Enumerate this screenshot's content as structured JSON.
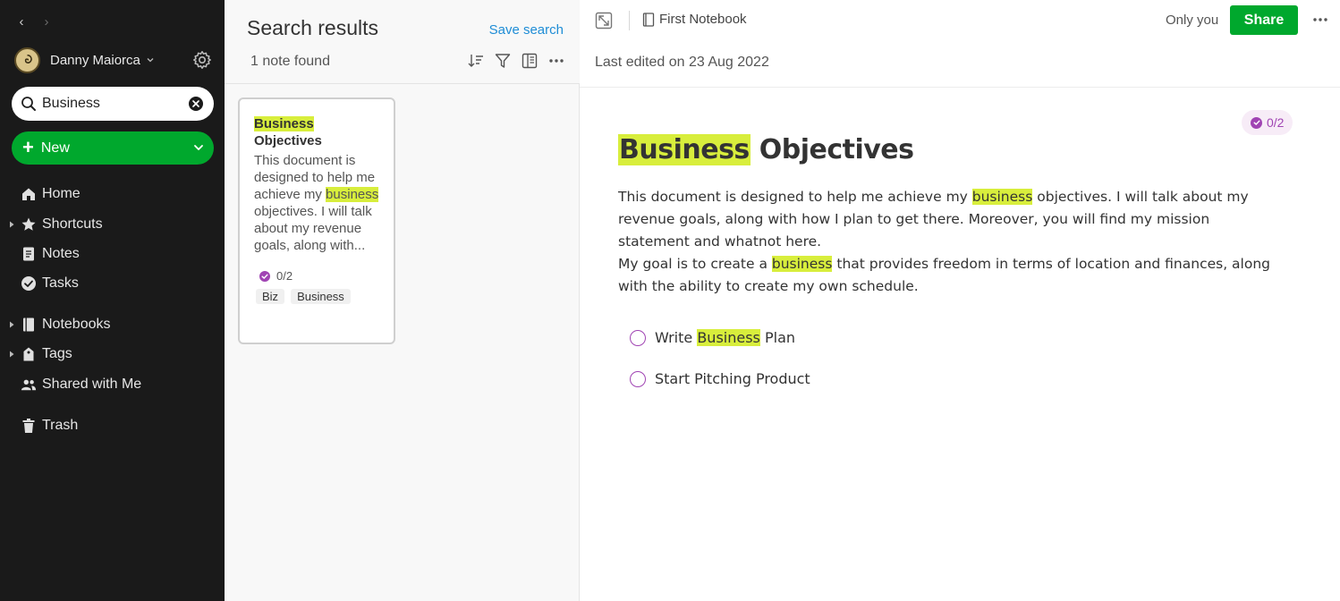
{
  "sidebar": {
    "user": {
      "name": "Danny Maiorca"
    },
    "search": {
      "value": "Business",
      "placeholder": "Search"
    },
    "new_button": {
      "label": "New"
    },
    "items": [
      {
        "label": "Home",
        "icon": "home-icon",
        "expandable": false
      },
      {
        "label": "Shortcuts",
        "icon": "star-icon",
        "expandable": true
      },
      {
        "label": "Notes",
        "icon": "notes-icon",
        "expandable": false
      },
      {
        "label": "Tasks",
        "icon": "check-circle-icon",
        "expandable": false
      },
      {
        "label": "Notebooks",
        "icon": "notebook-icon",
        "expandable": true
      },
      {
        "label": "Tags",
        "icon": "tag-icon",
        "expandable": true
      },
      {
        "label": "Shared with Me",
        "icon": "people-icon",
        "expandable": false
      },
      {
        "label": "Trash",
        "icon": "trash-icon",
        "expandable": false
      }
    ]
  },
  "results": {
    "title": "Search results",
    "save_search": "Save search",
    "count": "1 note found",
    "card": {
      "title_highlight": "Business",
      "title_rest": "Objectives",
      "snippet_before": "This document is designed to help me achieve my ",
      "snippet_highlight": "business",
      "snippet_after": " objectives. I will talk about my revenue goals, along with...",
      "task_count": "0/2",
      "tags": [
        "Biz",
        "Business"
      ]
    }
  },
  "editor": {
    "notebook": "First Notebook",
    "visibility": "Only you",
    "share_label": "Share",
    "last_edited": "Last edited on 23 Aug 2022",
    "task_badge": "0/2",
    "title_highlight": "Business",
    "title_rest": " Objectives",
    "p1_before": "This document is designed to help me achieve my ",
    "p1_highlight": "business",
    "p1_after": " objectives. I will talk about my revenue goals, along with how I plan to get there. Moreover, you will find my mission statement and whatnot here.",
    "p2_before": "My goal is to create a ",
    "p2_highlight": "business",
    "p2_after": " that provides freedom in terms of location and finances, along with the ability to create my own schedule.",
    "todos": [
      {
        "before": "Write ",
        "highlight": "Business",
        "after": " Plan",
        "done": false
      },
      {
        "before": "Start Pitching Product",
        "highlight": "",
        "after": "",
        "done": false
      }
    ]
  },
  "colors": {
    "accent": "#00a82d",
    "highlight": "#d8ee3c",
    "task": "#a044b3",
    "link": "#1f8dd6",
    "sidebar_bg": "#1a1a1a"
  }
}
